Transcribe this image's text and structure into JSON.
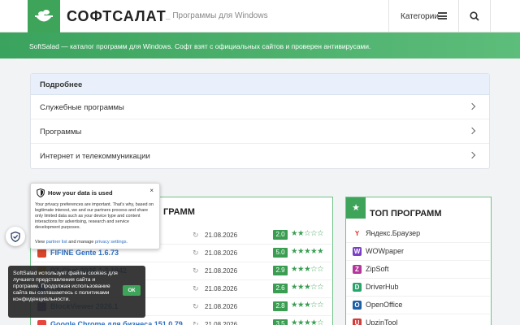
{
  "header": {
    "brand": "СОФТСАЛАТ",
    "tagline": "Программы для Windows",
    "categories_label": "Категории"
  },
  "banner": {
    "text": "SoftSalad — каталог программ для Windows. Софт взят с официальных сайтов и проверен антивирусами."
  },
  "details": {
    "title": "Подробнее",
    "items": [
      "Служебные программы",
      "Программы",
      "Интернет и телекоммуникации"
    ]
  },
  "left_list": {
    "title": "ГРАММ",
    "rows": [
      {
        "name": "",
        "date": "21.08.2026",
        "score": "2.0",
        "stars": 2,
        "icon_color": "#8a8a8a"
      },
      {
        "name": "FIFINE Gente 1.6.73",
        "date": "21.08.2026",
        "score": "5.0",
        "stars": 5,
        "icon_color": "#d9452b"
      },
      {
        "name": "PT-Chat 2026.1.2 1942",
        "date": "21.08.2026",
        "score": "2.9",
        "stars": 3,
        "icon_color": "#e0a21b"
      },
      {
        "name": "4.6.0",
        "date": "21.08.2026",
        "score": "2.6",
        "stars": 3,
        "icon_color": "#4a7fd4"
      },
      {
        "name": "BlockViewer 2026.1",
        "date": "21.08.2026",
        "score": "2.8",
        "stars": 3,
        "icon_color": "#6c4bb8"
      },
      {
        "name": "Google Chrome для бизнеса 151.0.79...",
        "date": "21.08.2026",
        "score": "3.5",
        "stars": 4,
        "icon_color": "#e8453c"
      }
    ]
  },
  "top_list": {
    "title": "ТОП ПРОГРАММ",
    "items": [
      {
        "name": "Яндекс.Браузер",
        "icon": "Y",
        "color": "#ffffff",
        "fg": "#e52620"
      },
      {
        "name": "WOWpaper",
        "icon": "W",
        "color": "#7a3fc5",
        "fg": "#ffffff"
      },
      {
        "name": "ZipSoft",
        "icon": "Z",
        "color": "#b4379c",
        "fg": "#ffffff"
      },
      {
        "name": "DriverHub",
        "icon": "D",
        "color": "#27a56a",
        "fg": "#ffffff"
      },
      {
        "name": "OpenOffice",
        "icon": "O",
        "color": "#1d5fa8",
        "fg": "#ffffff"
      },
      {
        "name": "UpzinTool",
        "icon": "U",
        "color": "#d03d3d",
        "fg": "#ffffff"
      }
    ]
  },
  "privacy": {
    "title": "How your data is used",
    "close": "×",
    "body": "Your privacy preferences are important. That's why, based on legitimate interest, we and our partners process and share only limited data such as your device type and content interactions for advertising, research and service development purposes.",
    "foot_prefix": "View",
    "partner_link": "partner list",
    "foot_mid": "and manage",
    "settings_link": "privacy settings."
  },
  "cookie": {
    "text": "SoftSalad использует файлы cookies для лучшего представления сайта и программ. Продолжая использование сайта вы соглашаетесь с политиками конфиденциальности.",
    "ok": "ОК"
  }
}
